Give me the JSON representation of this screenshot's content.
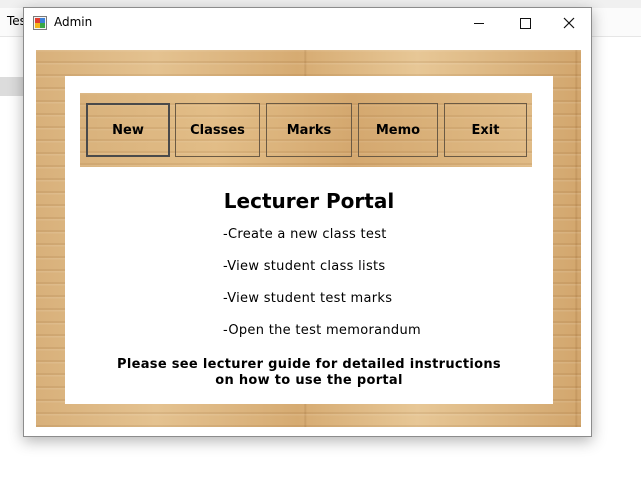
{
  "background": {
    "tab_label": "Tes"
  },
  "window": {
    "title": "Admin",
    "icon": "app-icon",
    "controls": {
      "minimize_icon": "minimize-icon",
      "maximize_icon": "maximize-icon",
      "close_icon": "close-icon",
      "close_glyph": "✕"
    }
  },
  "toolbar": {
    "buttons": [
      {
        "label": "New",
        "active": true
      },
      {
        "label": "Classes"
      },
      {
        "label": "Marks"
      },
      {
        "label": "Memo"
      },
      {
        "label": "Exit"
      }
    ]
  },
  "content": {
    "title": "Lecturer Portal",
    "bullets": [
      "-Create a new class test",
      "-View student class lists",
      "-View student test marks",
      "-Open the test memorandum"
    ],
    "note_line1": "Please see lecturer guide for detailed instructions",
    "note_line2": "on how to use the portal"
  },
  "colors": {
    "wood": "#d9b07a",
    "panel": "#ffffff",
    "button_border": "#6b5a44"
  }
}
